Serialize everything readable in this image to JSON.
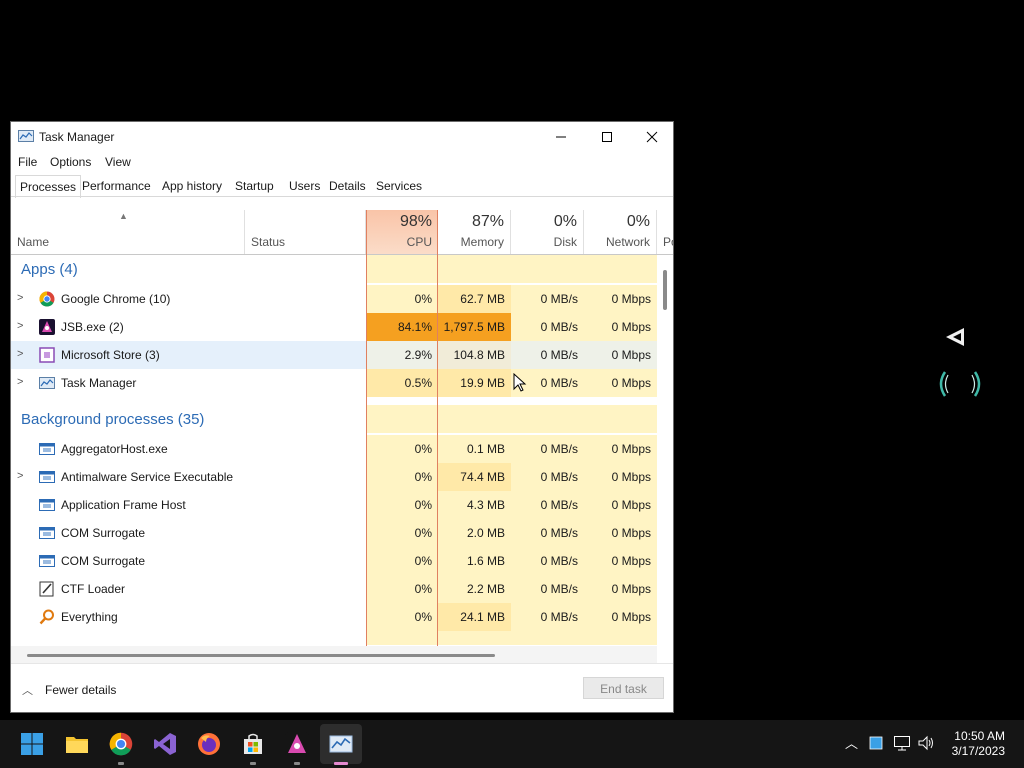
{
  "window": {
    "title": "Task Manager",
    "controls": [
      "minimize",
      "maximize",
      "close"
    ]
  },
  "menu": [
    "File",
    "Options",
    "View"
  ],
  "tabs": [
    "Processes",
    "Performance",
    "App history",
    "Startup",
    "Users",
    "Details",
    "Services"
  ],
  "header": {
    "name": "Name",
    "status": "Status",
    "cpu_pct": "98%",
    "cpu_label": "CPU",
    "mem_pct": "87%",
    "mem_label": "Memory",
    "disk_pct": "0%",
    "disk_label": "Disk",
    "net_pct": "0%",
    "net_label": "Network",
    "power_label": "Po"
  },
  "groups": {
    "apps": "Apps (4)",
    "background": "Background processes (35)"
  },
  "apps": [
    {
      "name": "Google Chrome (10)",
      "cpu": "0%",
      "mem": "62.7 MB",
      "disk": "0 MB/s",
      "net": "0 Mbps",
      "icon": "chrome-icon"
    },
    {
      "name": "JSB.exe (2)",
      "cpu": "84.1%",
      "mem": "1,797.5 MB",
      "disk": "0 MB/s",
      "net": "0 Mbps",
      "icon": "jsb-icon"
    },
    {
      "name": "Microsoft Store (3)",
      "cpu": "2.9%",
      "mem": "104.8 MB",
      "disk": "0 MB/s",
      "net": "0 Mbps",
      "icon": "store-icon"
    },
    {
      "name": "Task Manager",
      "cpu": "0.5%",
      "mem": "19.9 MB",
      "disk": "0 MB/s",
      "net": "0 Mbps",
      "icon": "taskmanager-icon"
    }
  ],
  "background": [
    {
      "name": "AggregatorHost.exe",
      "cpu": "0%",
      "mem": "0.1 MB",
      "disk": "0 MB/s",
      "net": "0 Mbps",
      "icon": "process-icon"
    },
    {
      "name": "Antimalware Service Executable",
      "cpu": "0%",
      "mem": "74.4 MB",
      "disk": "0 MB/s",
      "net": "0 Mbps",
      "icon": "process-icon"
    },
    {
      "name": "Application Frame Host",
      "cpu": "0%",
      "mem": "4.3 MB",
      "disk": "0 MB/s",
      "net": "0 Mbps",
      "icon": "process-icon"
    },
    {
      "name": "COM Surrogate",
      "cpu": "0%",
      "mem": "2.0 MB",
      "disk": "0 MB/s",
      "net": "0 Mbps",
      "icon": "process-icon"
    },
    {
      "name": "COM Surrogate",
      "cpu": "0%",
      "mem": "1.6 MB",
      "disk": "0 MB/s",
      "net": "0 Mbps",
      "icon": "process-icon"
    },
    {
      "name": "CTF Loader",
      "cpu": "0%",
      "mem": "2.2 MB",
      "disk": "0 MB/s",
      "net": "0 Mbps",
      "icon": "ctf-icon"
    },
    {
      "name": "Everything",
      "cpu": "0%",
      "mem": "24.1 MB",
      "disk": "0 MB/s",
      "net": "0 Mbps",
      "icon": "everything-icon"
    }
  ],
  "footer": {
    "fewer": "Fewer details",
    "end_task": "End task"
  },
  "clock": {
    "time": "10:50 AM",
    "date": "3/17/2023"
  },
  "colors": {
    "cpu_header": "#f9c4a8",
    "cpu_hot": "#f5a020",
    "cell_light": "#fff4c4",
    "cell_mid": "#ffe9a8",
    "group_blue": "#2c6bb5"
  }
}
